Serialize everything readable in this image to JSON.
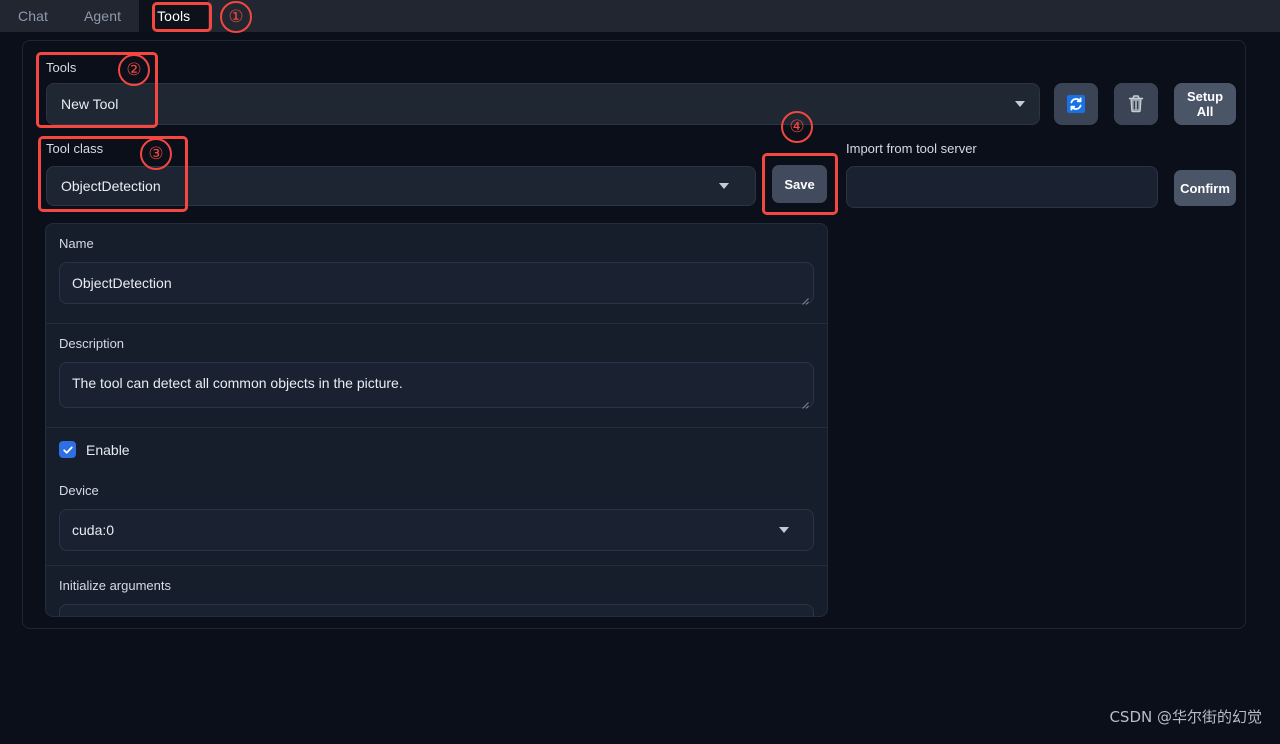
{
  "tabs": [
    {
      "label": "Chat",
      "active": false
    },
    {
      "label": "Agent",
      "active": false
    },
    {
      "label": "Tools",
      "active": true
    }
  ],
  "tools_row": {
    "label": "Tools",
    "selected": "New Tool",
    "refresh_icon": "refresh-icon",
    "trash_icon": "trash-icon",
    "setup_all_line1": "Setup",
    "setup_all_line2": "All"
  },
  "tool_class_row": {
    "label": "Tool class",
    "selected": "ObjectDetection",
    "save_label": "Save",
    "import_label": "Import from tool server",
    "import_value": "",
    "import_placeholder": "",
    "confirm_label": "Confirm"
  },
  "form": {
    "name": {
      "label": "Name",
      "value": "ObjectDetection"
    },
    "description": {
      "label": "Description",
      "value": "The tool can detect all common objects in the picture."
    },
    "enable": {
      "label": "Enable",
      "checked": true
    },
    "device": {
      "label": "Device",
      "value": "cuda:0"
    },
    "init_args": {
      "label": "Initialize arguments",
      "value": "",
      "placeholder": ""
    }
  },
  "annotations": [
    {
      "id": "1",
      "glyph": "①"
    },
    {
      "id": "2",
      "glyph": "②"
    },
    {
      "id": "3",
      "glyph": "③"
    },
    {
      "id": "4",
      "glyph": "④"
    }
  ],
  "watermark": "CSDN @华尔街的幻觉",
  "colors": {
    "accent_red": "#f4473f",
    "checkbox_blue": "#2f6fe4",
    "refresh_blue": "#1971e6",
    "header_bg": "#212631",
    "page_bg": "#0b0f19"
  }
}
